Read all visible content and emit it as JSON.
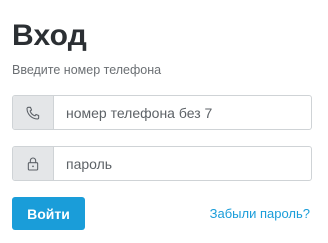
{
  "header": {
    "title": "Вход",
    "subtitle": "Введите номер телефона"
  },
  "form": {
    "phone": {
      "icon": "phone-icon",
      "placeholder": "номер телефона без 7",
      "value": ""
    },
    "password": {
      "icon": "lock-icon",
      "placeholder": "пароль",
      "value": ""
    },
    "submit_label": "Войти",
    "forgot_label": "Забыли пароль?"
  },
  "colors": {
    "accent": "#1a9dd9",
    "title": "#2b2f33",
    "addon_bg": "#e4e6e8",
    "border": "#cfd3d6"
  }
}
